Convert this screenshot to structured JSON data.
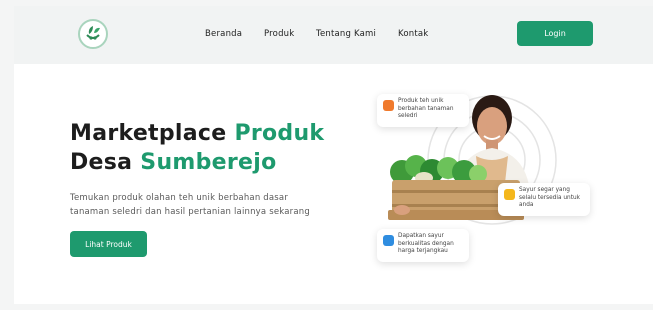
{
  "nav": {
    "links": [
      "Beranda",
      "Produk",
      "Tentang Kami",
      "Kontak"
    ],
    "login_label": "Login",
    "logo_icon": "leaf-basket-logo"
  },
  "hero": {
    "title_line1_a": "Marketplace",
    "title_line1_b": "Produk",
    "title_line2_a": "Desa",
    "title_line2_b": "Sumberejo",
    "desc_line1": "Temukan produk olahan teh unik berbahan dasar",
    "desc_line2": "tanaman seledri dan hasil pertanian lainnya sekarang",
    "cta_label": "Lihat Produk"
  },
  "cards": [
    {
      "lines": [
        "Produk teh unik",
        "berbahan tanaman",
        "seledri"
      ],
      "icon": "tea-icon",
      "color": "#f07a2d"
    },
    {
      "lines": [
        "Sayur segar yang",
        "selalu tersedia untuk",
        "anda"
      ],
      "icon": "vegetable-icon",
      "color": "#f4b71c"
    },
    {
      "lines": [
        "Dapatkan sayur",
        "berkualitas dengan",
        "harga terjangkau"
      ],
      "icon": "price-tag-icon",
      "color": "#2f8de0"
    }
  ],
  "colors": {
    "accent": "#1e9a6e",
    "background": "#f4f5f5",
    "card": "#ffffff"
  }
}
